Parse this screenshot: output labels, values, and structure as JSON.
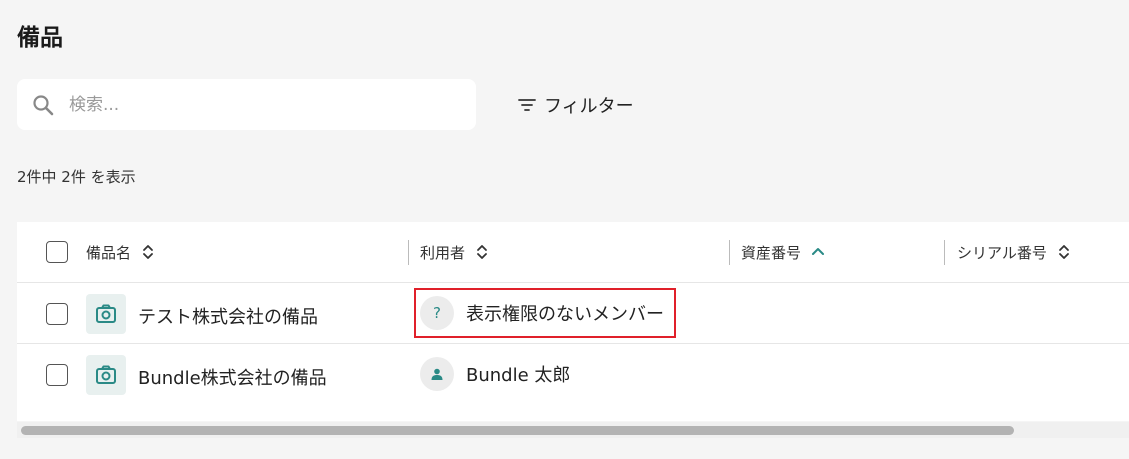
{
  "page": {
    "title": "備品"
  },
  "search": {
    "placeholder": "検索...",
    "value": ""
  },
  "filter": {
    "label": "フィルター"
  },
  "result_count": "2件中 2件 を表示",
  "table": {
    "columns": [
      {
        "label": "備品名",
        "sort": "unsorted"
      },
      {
        "label": "利用者",
        "sort": "unsorted"
      },
      {
        "label": "資産番号",
        "sort": "ascending"
      },
      {
        "label": "シリアル番号",
        "sort": "unsorted"
      }
    ],
    "rows": [
      {
        "item_name": "テスト株式会社の備品",
        "user_name": "表示権限のないメンバー",
        "user_avatar": "?",
        "user_avatar_icon": "unknown-user-icon",
        "asset_number": "",
        "serial_number": "",
        "user_highlighted": true
      },
      {
        "item_name": "Bundle株式会社の備品",
        "user_name": "Bundle 太郎",
        "user_avatar": "",
        "user_avatar_icon": "person-icon",
        "asset_number": "",
        "serial_number": "",
        "user_highlighted": false
      }
    ]
  },
  "colors": {
    "accent": "#2a8a86",
    "highlight_border": "#e0202a",
    "background": "#f5f5f5"
  }
}
